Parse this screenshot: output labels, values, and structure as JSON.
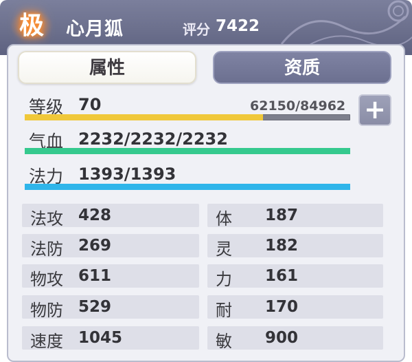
{
  "header": {
    "grade_badge": "极",
    "pet_name": "心月狐",
    "score_label": "评分",
    "score_value": "7422"
  },
  "tabs": [
    {
      "label": "属性",
      "selected": true
    },
    {
      "label": "资质",
      "selected": false
    }
  ],
  "bars": {
    "level": {
      "label": "等级",
      "value": "70",
      "exp_text": "62150/84962",
      "fill_fraction": 0.7315,
      "color": "#f0c83a"
    },
    "hp": {
      "label": "气血",
      "value": "2232/2232/2232",
      "fill_fraction": 1.0,
      "color": "#35c98e"
    },
    "mp": {
      "label": "法力",
      "value": "1393/1393",
      "fill_fraction": 1.0,
      "color": "#2fb5ea"
    }
  },
  "plus_button": {
    "icon": "plus-icon",
    "glyph": "+"
  },
  "attributes": {
    "left": [
      {
        "label": "法攻",
        "value": "428"
      },
      {
        "label": "法防",
        "value": "269"
      },
      {
        "label": "物攻",
        "value": "611"
      },
      {
        "label": "物防",
        "value": "529"
      },
      {
        "label": "速度",
        "value": "1045"
      }
    ],
    "right": [
      {
        "label": "体",
        "value": "187"
      },
      {
        "label": "灵",
        "value": "182"
      },
      {
        "label": "力",
        "value": "161"
      },
      {
        "label": "耐",
        "value": "170"
      },
      {
        "label": "敏",
        "value": "900"
      }
    ]
  }
}
